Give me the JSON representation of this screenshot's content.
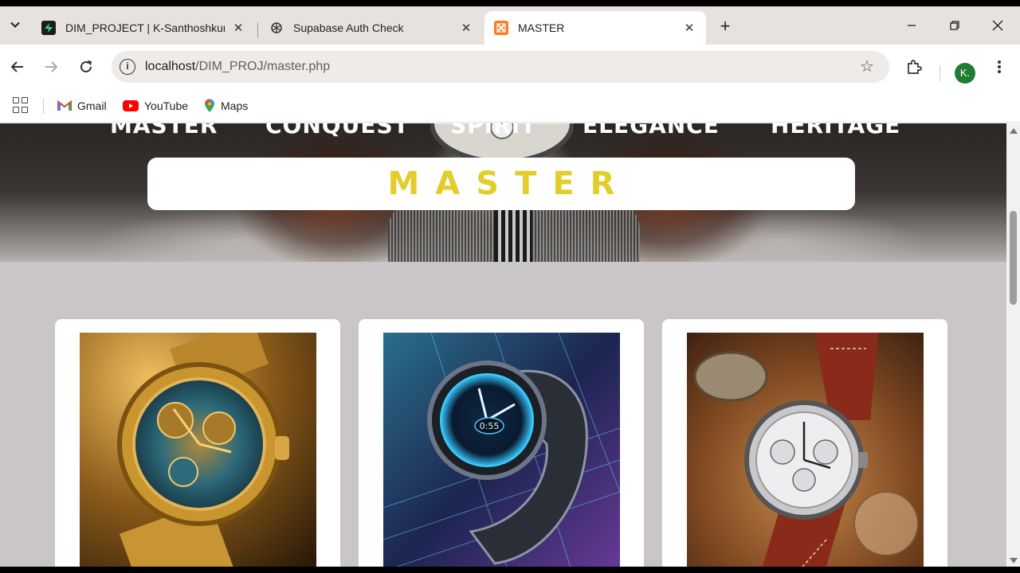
{
  "tabs": [
    {
      "title": "DIM_PROJECT | K-Santhoshkum",
      "icon": "supabase-bolt-icon",
      "active": false
    },
    {
      "title": "Supabase Auth Check",
      "icon": "openai-icon",
      "active": false
    },
    {
      "title": "MASTER",
      "icon": "xampp-icon",
      "active": true
    }
  ],
  "toolbar": {
    "url_host": "localhost",
    "url_path": "/DIM_PROJ/master.php",
    "profile_initial": "K."
  },
  "bookmarks": [
    {
      "label": "Gmail",
      "icon": "gmail-icon"
    },
    {
      "label": "YouTube",
      "icon": "youtube-icon"
    },
    {
      "label": "Maps",
      "icon": "maps-icon"
    }
  ],
  "page": {
    "nav": [
      "MASTER",
      "CONQUEST",
      "SPIRIT",
      "ELEGANCE",
      "HERITAGE"
    ],
    "banner_title": "MASTER",
    "cards": [
      {
        "image": "gold-skeleton-watch"
      },
      {
        "image": "futuristic-smartwatch",
        "watch_time": "0:55"
      },
      {
        "image": "leather-chronograph-watch"
      }
    ]
  },
  "colors": {
    "banner_text": "#e3cd2a",
    "tabstrip_bg": "#e8e2df",
    "page_bg": "#cac6c7"
  }
}
